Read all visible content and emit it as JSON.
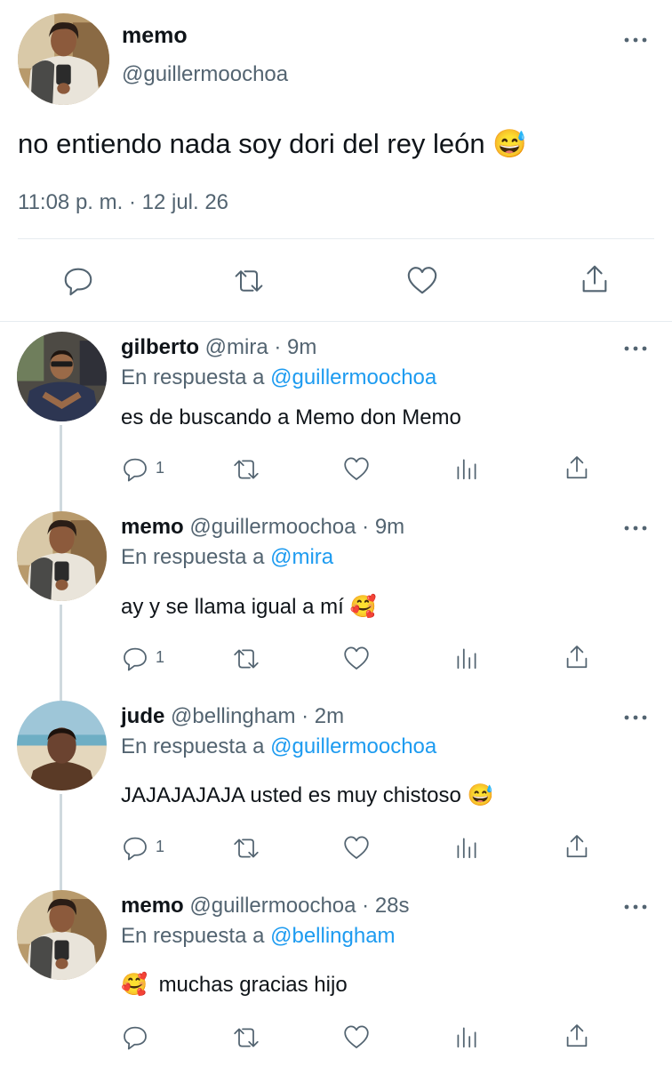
{
  "main_tweet": {
    "display_name": "memo",
    "handle": "@guillermoochoa",
    "text": "no entiendo nada soy dori del rey león",
    "emoji": "😅",
    "timestamp": "11:08 p. m. · 12 jul. 26"
  },
  "replies": [
    {
      "display_name": "gilberto",
      "handle_time": "@mira · 9m",
      "reply_prefix": "En respuesta a",
      "reply_to": "@guillermoochoa",
      "text": "es de buscando a Memo don Memo",
      "reply_count": "1"
    },
    {
      "display_name": "memo",
      "handle_time": "@guillermoochoa · 9m",
      "reply_prefix": "En respuesta a",
      "reply_to": "@mira",
      "text": "ay y se llama igual a mí",
      "emoji": "🥰",
      "reply_count": "1"
    },
    {
      "display_name": "jude",
      "handle_time": "@bellingham · 2m",
      "reply_prefix": "En respuesta a",
      "reply_to": "@guillermoochoa",
      "text": "JAJAJAJAJA usted es muy chistoso",
      "emoji": "😅",
      "reply_count": "1"
    },
    {
      "display_name": "memo",
      "handle_time": "@guillermoochoa · 28s",
      "reply_prefix": "En respuesta a",
      "reply_to": "@bellingham",
      "emoji": "🥰",
      "text": "muchas gracias hijo",
      "reply_count": ""
    }
  ],
  "icons": [
    "more-icon",
    "reply-icon",
    "retweet-icon",
    "like-icon",
    "share-icon",
    "analytics-icon"
  ],
  "colors": {
    "link": "#1d9bf0",
    "secondary": "#536471",
    "divider": "#e6ecf0"
  }
}
